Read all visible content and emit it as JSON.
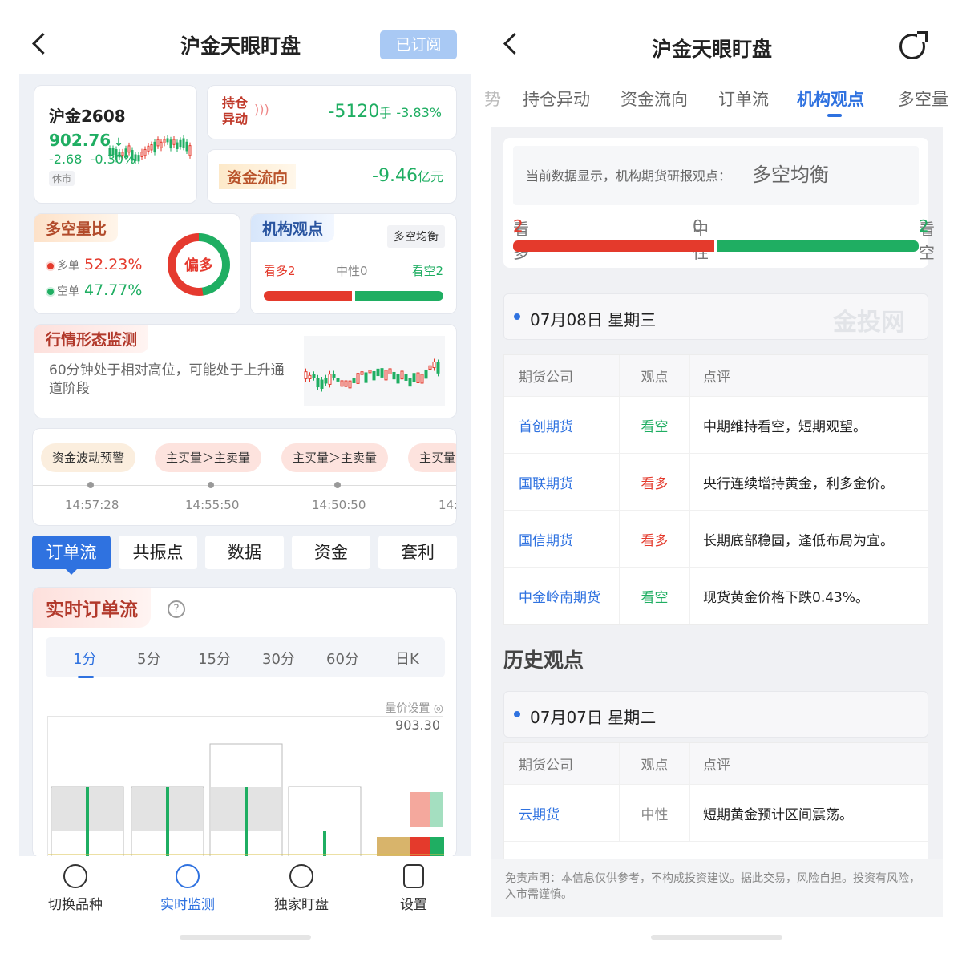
{
  "left": {
    "header": {
      "title": "沪金天眼盯盘",
      "subscribe_label": "已订阅"
    },
    "quote": {
      "name": "沪金2608",
      "price": "902.76",
      "change": "-2.68",
      "change_pct": "-0.30%",
      "status": "休市"
    },
    "position": {
      "tag": "持仓异动",
      "value": "-5120",
      "unit": "手",
      "pct": "-3.83%"
    },
    "fund": {
      "tag": "资金流向",
      "value": "-9.46",
      "unit": "亿元"
    },
    "long_short": {
      "tag": "多空量比",
      "long_label": "多单",
      "long_value": "52.23%",
      "short_label": "空单",
      "short_value": "47.77%",
      "donut_label": "偏多",
      "long_fraction": 0.5223
    },
    "org_view": {
      "tag": "机构观点",
      "badge": "多空均衡",
      "bull": "看多2",
      "neutral": "中性0",
      "bear": "看空2",
      "bull_count": 2,
      "bear_count": 2
    },
    "monitor": {
      "tag": "行情形态监测",
      "text": "60分钟处于相对高位，可能处于上升通道阶段"
    },
    "alerts": {
      "pills": [
        "资金波动预警",
        "主买量＞主卖量",
        "主买量＞主卖量",
        "主买量"
      ],
      "times": [
        "14:57:28",
        "14:55:50",
        "14:50:50",
        "14:"
      ]
    },
    "tabs": [
      "订单流",
      "共振点",
      "数据",
      "资金",
      "套利"
    ],
    "flow": {
      "tag": "实时订单流",
      "help": "?",
      "periods": [
        "1分",
        "5分",
        "15分",
        "30分",
        "60分",
        "日K"
      ],
      "qp_settings": "量价设置",
      "price_top": "903.30"
    },
    "bottom_nav": [
      "切换品种",
      "实时监测",
      "独家盯盘",
      "设置"
    ]
  },
  "right": {
    "header": {
      "title": "沪金天眼盯盘"
    },
    "tabs": [
      "势",
      "持仓异动",
      "资金流向",
      "订单流",
      "机构观点",
      "多空量"
    ],
    "summary": {
      "text": "当前数据显示，机构期货研报观点：",
      "value": "多空均衡",
      "bull_label": "看多",
      "bull_count": "2",
      "neutral_label": "中性",
      "neutral_count": "0",
      "bear_label": "看空",
      "bear_count": "2"
    },
    "today": {
      "date": "07月08日  星期三",
      "watermark": "金投网",
      "headers": [
        "期货公司",
        "观点",
        "点评"
      ],
      "rows": [
        {
          "company": "首创期货",
          "view": "看空",
          "comment": "中期维持看空，短期观望。"
        },
        {
          "company": "国联期货",
          "view": "看多",
          "comment": "央行连续增持黄金，利多金价。"
        },
        {
          "company": "国信期货",
          "view": "看多",
          "comment": "长期底部稳固，逢低布局为宜。"
        },
        {
          "company": "中金岭南期货",
          "view": "看空",
          "comment": "现货黄金价格下跌0.43%。"
        }
      ]
    },
    "history": {
      "title": "历史观点",
      "date": "07月07日  星期二",
      "headers": [
        "期货公司",
        "观点",
        "点评"
      ],
      "rows": [
        {
          "company": "云期货",
          "view": "中性",
          "comment": "短期黄金预计区间震荡。"
        }
      ]
    },
    "disclaimer": "免责声明：本信息仅供参考，不构成投资建议。据此交易，风险自担。投资有风险，入市需谨慎。"
  },
  "colors": {
    "bull": "#e43a2c",
    "bear": "#1fae62",
    "neutral": "#888888",
    "accent": "#2f72e0"
  }
}
